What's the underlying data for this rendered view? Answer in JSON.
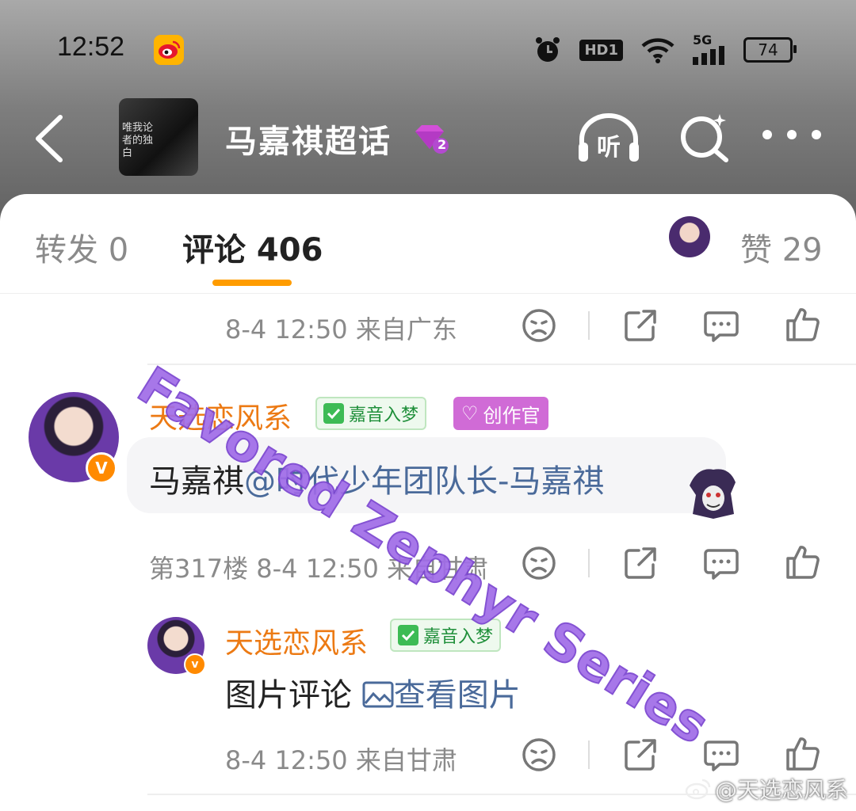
{
  "status_bar": {
    "time": "12:52",
    "network": "5G",
    "hd_label": "HD1",
    "battery": "74"
  },
  "header": {
    "thumbnail_text": "唯我论者的独白",
    "title": "马嘉祺超话",
    "level_badge": "2"
  },
  "tabs": {
    "forward_label": "转发 0",
    "comments_label": "评论 406",
    "likes_label": "赞 29",
    "accent_color": "#ff9c00"
  },
  "comments": [
    {
      "meta": "8-4 12:50 来自广东"
    },
    {
      "username": "天选恋风系",
      "badge_fan": "嘉音入梦",
      "badge_creator": "创作官",
      "text_prefix": "马嘉祺",
      "mention": "@时代少年团队长-马嘉祺",
      "meta": "第317楼 8-4 12:50 来自甘肃",
      "verified_mark": "V"
    },
    {
      "username": "天选恋风系",
      "badge_fan": "嘉音入梦",
      "text_prefix": "图片评论",
      "link_text": "查看图片",
      "meta": "8-4 12:50 来自甘肃",
      "verified_mark": "v"
    }
  ],
  "overlay": {
    "watermark": "Favored Zephyr Series",
    "weibo_watermark": "@天选恋风系"
  },
  "colors": {
    "username": "#ec7a14",
    "link": "#4a6a9a",
    "verified": "#ff8a00"
  }
}
